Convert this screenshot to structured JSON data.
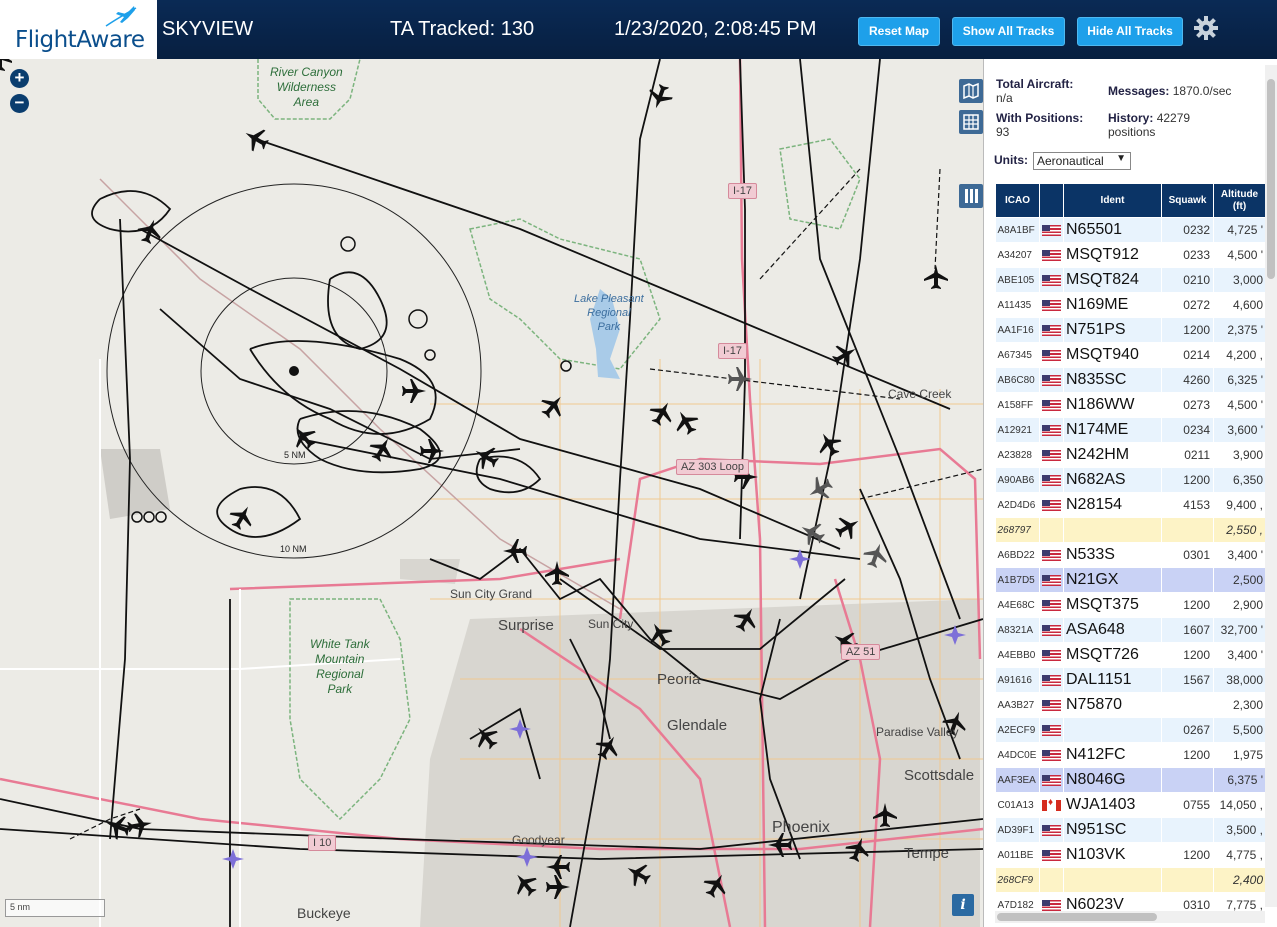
{
  "header": {
    "logo": "FlightAware",
    "title": "SKYVIEW",
    "tracked": "TA Tracked: 130",
    "clock": "1/23/2020, 2:08:45 PM",
    "buttons": {
      "reset": "Reset Map",
      "show_all": "Show All Tracks",
      "hide_all": "Hide All Tracks"
    }
  },
  "map": {
    "zoom_in": "+",
    "zoom_out": "−",
    "places": {
      "surprise": "Surprise",
      "sun_city": "Sun City",
      "sun_city_grand": "Sun City Grand",
      "peoria": "Peoria",
      "glendale": "Glendale",
      "phoenix": "Phoenix",
      "tempe": "Tempe",
      "scottsdale": "Scottsdale",
      "paradise_valley": "Paradise Valley",
      "cave_creek": "Cave Creek",
      "goodyear": "Goodyear",
      "buckeye": "Buckeye"
    },
    "parks": {
      "hassayampa": "River Canyon\nWilderness\nArea",
      "white_tank": "White Tank\nMountain\nRegional\nPark",
      "lake_pleasant": "Lake Pleasant\nRegional\nPark"
    },
    "shields": {
      "i17_top": "I-17",
      "i17_mid": "I-17",
      "az303": "AZ 303 Loop",
      "az51": "AZ 51",
      "i10": "I 10"
    },
    "rings": {
      "inner": "5 NM",
      "outer": "10 NM"
    },
    "scale": "5 nm",
    "info": "i"
  },
  "stats": {
    "total_label": "Total Aircraft:",
    "total_value": "n/a",
    "positions_label": "With Positions:",
    "positions_value": "93",
    "messages_label": "Messages:",
    "messages_value": "1870.0/sec",
    "history_label": "History:",
    "history_value": "42279 positions",
    "units_label": "Units:",
    "units_value": "Aeronautical"
  },
  "table": {
    "headers": {
      "icao": "ICAO",
      "ident": "Ident",
      "squawk": "Squawk",
      "altitude": "Altitude (ft)"
    },
    "rows": [
      {
        "icao": "A8A1BF",
        "flag": "us",
        "ident": "N65501",
        "squawk": "0232",
        "alt": "4,725 '",
        "style": "r"
      },
      {
        "icao": "A34207",
        "flag": "us",
        "ident": "MSQT912",
        "squawk": "0233",
        "alt": "4,500 '",
        "style": "w"
      },
      {
        "icao": "ABE105",
        "flag": "us",
        "ident": "MSQT824",
        "squawk": "0210",
        "alt": "3,000",
        "style": "r"
      },
      {
        "icao": "A11435",
        "flag": "us",
        "ident": "N169ME",
        "squawk": "0272",
        "alt": "4,600",
        "style": "w"
      },
      {
        "icao": "AA1F16",
        "flag": "us",
        "ident": "N751PS",
        "squawk": "1200",
        "alt": "2,375 '",
        "style": "r"
      },
      {
        "icao": "A67345",
        "flag": "us",
        "ident": "MSQT940",
        "squawk": "0214",
        "alt": "4,200 ,",
        "style": "w"
      },
      {
        "icao": "AB6C80",
        "flag": "us",
        "ident": "N835SC",
        "squawk": "4260",
        "alt": "6,325 '",
        "style": "r"
      },
      {
        "icao": "A158FF",
        "flag": "us",
        "ident": "N186WW",
        "squawk": "0273",
        "alt": "4,500 '",
        "style": "w"
      },
      {
        "icao": "A12921",
        "flag": "us",
        "ident": "N174ME",
        "squawk": "0234",
        "alt": "3,600 '",
        "style": "r"
      },
      {
        "icao": "A23828",
        "flag": "us",
        "ident": "N242HM",
        "squawk": "0211",
        "alt": "3,900",
        "style": "w"
      },
      {
        "icao": "A90AB6",
        "flag": "us",
        "ident": "N682AS",
        "squawk": "1200",
        "alt": "6,350",
        "style": "r"
      },
      {
        "icao": "A2D4D6",
        "flag": "us",
        "ident": "N28154",
        "squawk": "4153",
        "alt": "9,400 ,",
        "style": "w"
      },
      {
        "icao": "268797",
        "flag": "",
        "ident": "",
        "squawk": "",
        "alt": "2,550 ,",
        "style": "noid"
      },
      {
        "icao": "A6BD22",
        "flag": "us",
        "ident": "N533S",
        "squawk": "0301",
        "alt": "3,400 '",
        "style": "w"
      },
      {
        "icao": "A1B7D5",
        "flag": "us",
        "ident": "N21GX",
        "squawk": "",
        "alt": "2,500",
        "style": "sel"
      },
      {
        "icao": "A4E68C",
        "flag": "us",
        "ident": "MSQT375",
        "squawk": "1200",
        "alt": "2,900",
        "style": "w"
      },
      {
        "icao": "A8321A",
        "flag": "us",
        "ident": "ASA648",
        "squawk": "1607",
        "alt": "32,700 '",
        "style": "r"
      },
      {
        "icao": "A4EBB0",
        "flag": "us",
        "ident": "MSQT726",
        "squawk": "1200",
        "alt": "3,400 '",
        "style": "w"
      },
      {
        "icao": "A91616",
        "flag": "us",
        "ident": "DAL1151",
        "squawk": "1567",
        "alt": "38,000",
        "style": "r"
      },
      {
        "icao": "AA3B27",
        "flag": "us",
        "ident": "N75870",
        "squawk": "",
        "alt": "2,300",
        "style": "w"
      },
      {
        "icao": "A2ECF9",
        "flag": "us",
        "ident": "",
        "squawk": "0267",
        "alt": "5,500",
        "style": "r"
      },
      {
        "icao": "A4DC0E",
        "flag": "us",
        "ident": "N412FC",
        "squawk": "1200",
        "alt": "1,975",
        "style": "w"
      },
      {
        "icao": "AAF3EA",
        "flag": "us",
        "ident": "N8046G",
        "squawk": "",
        "alt": "6,375 '",
        "style": "sel"
      },
      {
        "icao": "C01A13",
        "flag": "ca",
        "ident": "WJA1403",
        "squawk": "0755",
        "alt": "14,050 ,",
        "style": "w"
      },
      {
        "icao": "AD39F1",
        "flag": "us",
        "ident": "N951SC",
        "squawk": "",
        "alt": "3,500 ,",
        "style": "r"
      },
      {
        "icao": "A011BE",
        "flag": "us",
        "ident": "N103VK",
        "squawk": "1200",
        "alt": "4,775 ,",
        "style": "w"
      },
      {
        "icao": "268CF9",
        "flag": "",
        "ident": "",
        "squawk": "",
        "alt": "2,400",
        "style": "noid"
      },
      {
        "icao": "A7D182",
        "flag": "us",
        "ident": "N6023V",
        "squawk": "0310",
        "alt": "7,775 ,",
        "style": "w"
      }
    ]
  }
}
